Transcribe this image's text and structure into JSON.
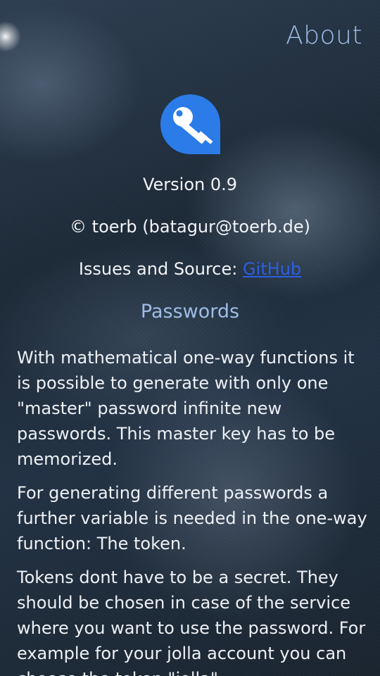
{
  "page": {
    "header_title": "About"
  },
  "app": {
    "icon": "key-icon",
    "icon_color": "#2b7be9",
    "version": "Version 0.9",
    "copyright": "© toerb (batagur@toerb.de)",
    "issues_label": "Issues and Source: ",
    "issues_link": "GitHub"
  },
  "section": {
    "title": "Passwords",
    "paragraphs": [
      "With mathematical one-way functions it is possible to generate with only one \"master\" password infinite new passwords. This master key has to be memorized.",
      "For generating different passwords a further variable is needed in the one-way function: The token.",
      "Tokens dont have to be a secret. They should be chosen in case of the service where you want to use the password. For example for your jolla account you can choose the token \"jolla\"."
    ]
  },
  "colors": {
    "highlight": "#9fbde6",
    "link": "#2c5fe0"
  }
}
